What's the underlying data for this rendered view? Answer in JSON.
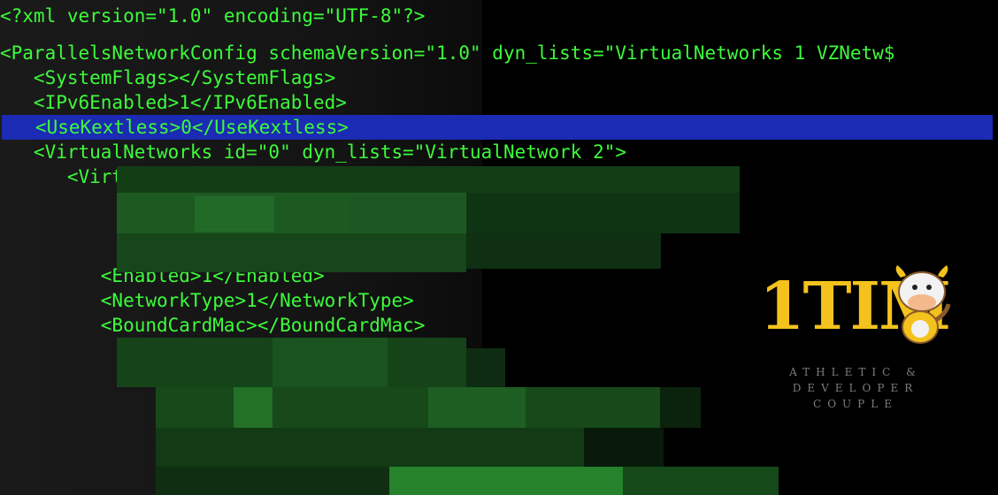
{
  "editor": {
    "lines": [
      "<?xml version=\"1.0\" encoding=\"UTF-8\"?>",
      "<ParallelsNetworkConfig schemaVersion=\"1.0\" dyn_lists=\"VirtualNetworks 1 VZNetw$",
      "   <SystemFlags></SystemFlags>",
      "   <IPv6Enabled>1</IPv6Enabled>",
      "   <UseKextless>0</UseKextless>",
      "   <VirtualNetworks id=\"0\" dyn_lists=\"VirtualNetwork 2\">",
      "      <VirtualNetwork id=\"0\" dyn_lists=\"VZVirtualNetw",
      "         <Enabled>1</Enabled>",
      "         <NetworkType>1</NetworkType>",
      "         <BoundCardMac></BoundCardMac>"
    ],
    "selected_line_index": 4,
    "text_color": "#3dfb3b",
    "selection_color": "#1b2bb3"
  },
  "watermark": {
    "logo_text": "1TIM",
    "tagline": [
      "ATHLETIC &",
      "DEVELOPER",
      "COUPLE"
    ],
    "logo_color": "#f4c21c",
    "mascot": "cow-mascot-icon"
  }
}
